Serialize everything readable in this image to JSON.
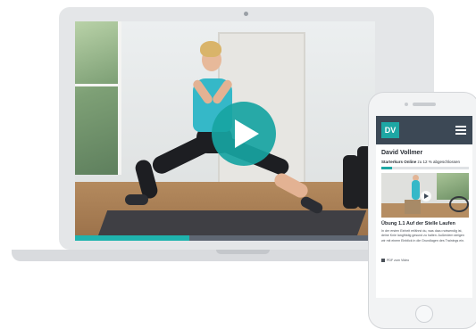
{
  "laptop": {
    "video": {
      "progress_fraction": 0.38,
      "play_icon": "play-icon"
    }
  },
  "phone": {
    "logo_text": "DV",
    "menu_icon": "hamburger-menu-icon",
    "trainer_name": "David Vollmer",
    "course_title": "Starterkurs Online",
    "course_progress_text": "zu 12 % abgeschlossen",
    "course_progress_fraction": 0.12,
    "lesson_title": "Übung 1.1 Auf der Stelle Laufen",
    "lesson_description": "In der ersten Einheit erfährst du, was dazu notwendig ist, deine Knie langfristig gesund zu halten. Außerdem steigen wir mit einem Einblick in die Grundlagen des Trainings ein.",
    "footer_text": "PDF zum Video"
  },
  "colors": {
    "accent": "#1ea7a4",
    "phone_header": "#3c4855"
  }
}
